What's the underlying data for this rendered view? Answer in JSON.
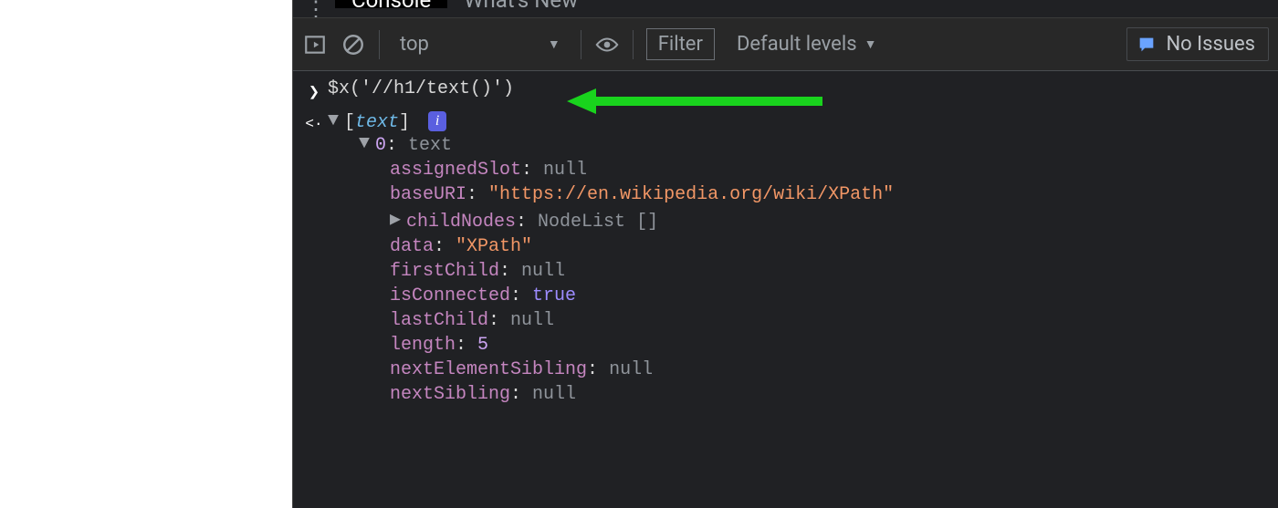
{
  "tabs": {
    "more": "⋮",
    "console": "Console",
    "whatsnew": "What's New"
  },
  "toolbar": {
    "context": "top",
    "filter_placeholder": "Filter",
    "levels": "Default levels",
    "no_issues": "No Issues"
  },
  "input": "$x('//h1/text()')",
  "result_header": "text",
  "result_index": "0",
  "result_index_type": "text",
  "props": {
    "assignedSlot": {
      "k": "assignedSlot",
      "v": "null"
    },
    "baseURI": {
      "k": "baseURI",
      "v": "\"https://en.wikipedia.org/wiki/XPath\""
    },
    "childNodes": {
      "k": "childNodes",
      "v": "NodeList []"
    },
    "data": {
      "k": "data",
      "v": "\"XPath\""
    },
    "firstChild": {
      "k": "firstChild",
      "v": "null"
    },
    "isConnected": {
      "k": "isConnected",
      "v": "true"
    },
    "lastChild": {
      "k": "lastChild",
      "v": "null"
    },
    "length": {
      "k": "length",
      "v": "5"
    },
    "nextElementSibling": {
      "k": "nextElementSibling",
      "v": "null"
    },
    "nextSibling": {
      "k": "nextSibling",
      "v": "null"
    }
  }
}
